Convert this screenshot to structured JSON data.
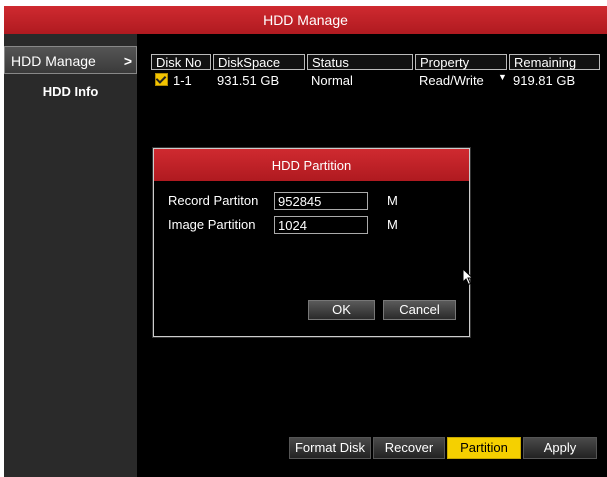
{
  "window": {
    "title": "HDD Manage"
  },
  "sidebar": {
    "items": [
      {
        "label": "HDD Manage",
        "chevron": ">",
        "active": true
      },
      {
        "label": "HDD Info",
        "active": false
      }
    ]
  },
  "table": {
    "columns": [
      "Disk No",
      "DiskSpace",
      "Status",
      "Property",
      "Remaining"
    ],
    "rows": [
      {
        "selected": true,
        "disk_no": "1-1",
        "disk_space": "931.51 GB",
        "status": "Normal",
        "property": "Read/Write",
        "remaining": "919.81 GB"
      }
    ]
  },
  "dialog": {
    "title": "HDD Partition",
    "record_label": "Record Partiton",
    "record_value": "952845",
    "record_unit": "M",
    "image_label": "Image Partition",
    "image_value": "1024",
    "image_unit": "M",
    "ok_label": "OK",
    "cancel_label": "Cancel"
  },
  "actions": {
    "format_label": "Format Disk",
    "recover_label": "Recover",
    "partition_label": "Partition",
    "apply_label": "Apply"
  },
  "colors": {
    "accent_red": "#c2222a",
    "highlight_yellow": "#f5d000"
  },
  "icons": {
    "checkbox": "checkmark-icon",
    "dropdown": "dropdown-arrow-icon",
    "cursor": "mouse-pointer-icon"
  }
}
